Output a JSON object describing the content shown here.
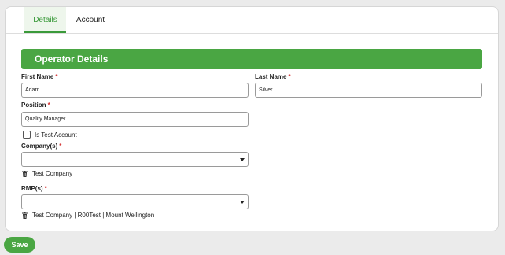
{
  "tabs": [
    {
      "label": "Details",
      "active": true
    },
    {
      "label": "Account",
      "active": false
    }
  ],
  "section": {
    "title": "Operator Details"
  },
  "fields": {
    "first_name": {
      "label": "First Name",
      "required_mark": "*",
      "value": "Adam"
    },
    "last_name": {
      "label": "Last Name",
      "required_mark": "*",
      "value": "Silver"
    },
    "position": {
      "label": "Position",
      "required_mark": "*",
      "value": "Quality Manager"
    },
    "is_test_account": {
      "label": "Is Test Account",
      "checked": false
    },
    "companies": {
      "label": "Company(s)",
      "required_mark": "*",
      "selected": "",
      "tags": [
        "Test Company"
      ]
    },
    "rmps": {
      "label": "RMP(s)",
      "required_mark": "*",
      "selected": "",
      "tags": [
        "Test Company | R00Test | Mount Wellington"
      ]
    }
  },
  "actions": {
    "save_label": "Save"
  },
  "colors": {
    "accent": "#4aa643",
    "required": "#d32f2f",
    "tab_active_bg": "#eef6ec"
  },
  "icons": {
    "tag_remove": "trash-icon",
    "select": "chevron-down-icon"
  }
}
